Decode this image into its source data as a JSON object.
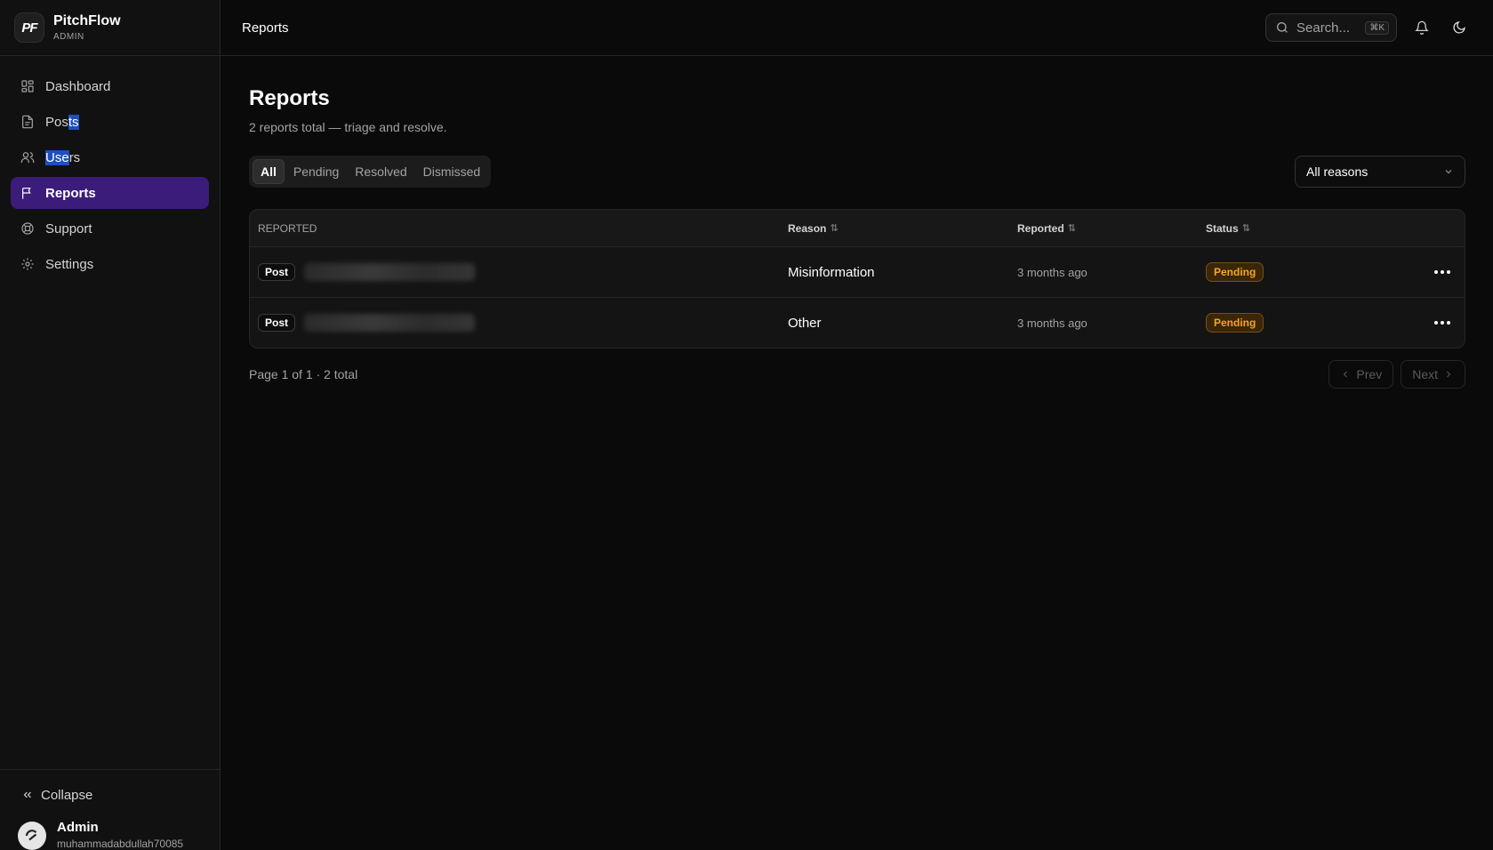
{
  "brand": {
    "logo": "PF",
    "name": "PitchFlow",
    "subtitle": "ADMIN"
  },
  "sidebar": {
    "items": [
      {
        "label": "Dashboard",
        "icon": "grid-icon"
      },
      {
        "label_a": "Pos",
        "label_b": "ts",
        "icon": "file-icon"
      },
      {
        "label_a": "Use",
        "label_b": "rs",
        "icon": "users-icon"
      },
      {
        "label": "Reports",
        "icon": "flag-icon",
        "active": true
      },
      {
        "label": "Support",
        "icon": "lifebuoy-icon"
      },
      {
        "label": "Settings",
        "icon": "gear-icon"
      }
    ],
    "collapse_label": "Collapse",
    "user": {
      "name": "Admin",
      "email": "muhammadabdullah70085"
    }
  },
  "header": {
    "title": "Reports",
    "search_placeholder": "Search...",
    "search_shortcut": "⌘K"
  },
  "page": {
    "title": "Reports",
    "subtitle": "2 reports total — triage and resolve.",
    "tabs": [
      "All",
      "Pending",
      "Resolved",
      "Dismissed"
    ],
    "active_tab": "All",
    "reason_filter": "All reasons"
  },
  "table": {
    "columns": {
      "reported": "REPORTED",
      "reason": "Reason",
      "reported_at": "Reported",
      "status": "Status"
    },
    "rows": [
      {
        "type": "Post",
        "reason": "Misinformation",
        "when": "3 months ago",
        "status": "Pending"
      },
      {
        "type": "Post",
        "reason": "Other",
        "when": "3 months ago",
        "status": "Pending"
      }
    ]
  },
  "pagination": {
    "info": "Page 1 of 1 · 2 total",
    "prev": "Prev",
    "next": "Next"
  },
  "colors": {
    "accent": "#3b1c7a",
    "pending": "#f5a524",
    "background": "#0a0a0a"
  }
}
